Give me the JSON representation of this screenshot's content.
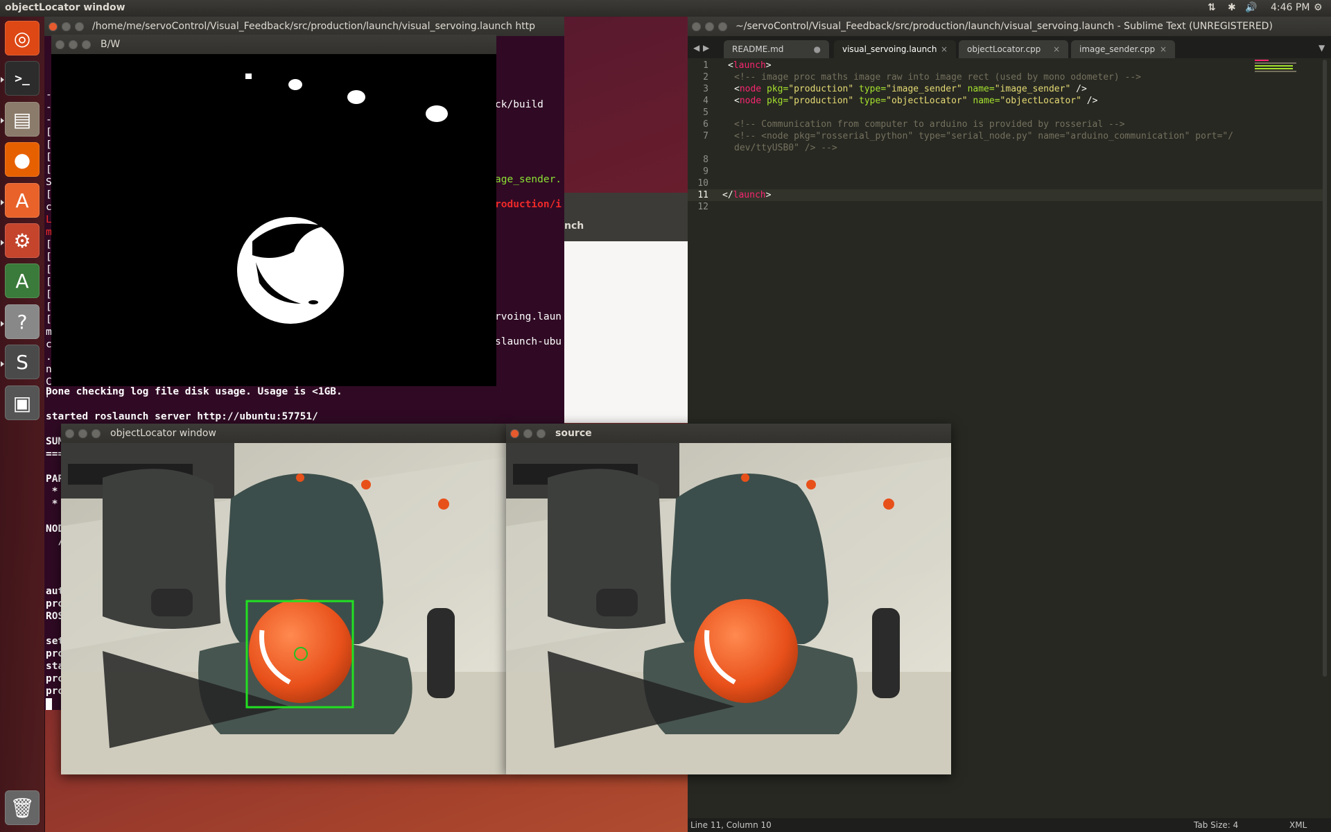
{
  "top_panel": {
    "title": "objectLocator window",
    "clock": "4:46 PM"
  },
  "launcher": {
    "items": [
      {
        "name": "ubuntu-dash-icon",
        "glyph": "◎",
        "color": "#dd4814"
      },
      {
        "name": "terminal-icon",
        "glyph": ">_",
        "color": "#2c2c2c"
      },
      {
        "name": "files-icon",
        "glyph": "▤",
        "color": "#8b7b6b"
      },
      {
        "name": "firefox-icon",
        "glyph": "●",
        "color": "#e66000"
      },
      {
        "name": "software-center-icon",
        "glyph": "A",
        "color": "#e8622a"
      },
      {
        "name": "system-settings-icon",
        "glyph": "⚙",
        "color": "#c4442c"
      },
      {
        "name": "update-manager-icon",
        "glyph": "A",
        "color": "#3a7a3a"
      },
      {
        "name": "help-icon",
        "glyph": "?",
        "color": "#888888"
      },
      {
        "name": "sublime-text-icon",
        "glyph": "S",
        "color": "#4a4a4a"
      },
      {
        "name": "save-icon",
        "glyph": "▣",
        "color": "#555555"
      },
      {
        "name": "trash-icon",
        "glyph": "🗑",
        "color": "#666666"
      }
    ]
  },
  "terminal": {
    "title": "/home/me/servoControl/Visual_Feedback/src/production/launch/visual_servoing.launch http",
    "right_fragments": [
      "ck/build",
      "age_sender.",
      "roduction/i",
      "rvoing.laun",
      "slaunch-ubu"
    ],
    "left_chars": [
      "-",
      "-",
      "-",
      "[",
      "[",
      "[",
      "[",
      "S",
      "[",
      "c",
      "L",
      "m",
      "[",
      "[",
      "[",
      "[",
      "[",
      "[",
      "[",
      "m",
      "c",
      ".",
      "n",
      "C",
      "P"
    ],
    "lines": [
      "Done checking log file disk usage. Usage is <1GB.",
      "",
      "started roslaunch server http://ubuntu:57751/",
      "",
      "SUM",
      "===",
      "",
      "PAR",
      " *",
      " *",
      "",
      "NOD",
      "  /",
      "",
      "",
      "",
      "aut",
      "pro",
      "ROS",
      "",
      "set",
      "pro",
      "sta",
      "pro",
      "pro"
    ],
    "partial_window_label": "nch"
  },
  "bw_window": {
    "title": "B/W"
  },
  "objectlocator_window": {
    "title": "objectLocator window"
  },
  "source_window": {
    "title": "source"
  },
  "sublime": {
    "title": "~/servoControl/Visual_Feedback/src/production/launch/visual_servoing.launch - Sublime Text (UNREGISTERED)",
    "tabs": [
      {
        "label": "README.md",
        "marker": "●",
        "active": false
      },
      {
        "label": "visual_servoing.launch",
        "marker": "×",
        "active": true
      },
      {
        "label": "objectLocator.cpp",
        "marker": "×",
        "active": false
      },
      {
        "label": "image_sender.cpp",
        "marker": "×",
        "active": false
      }
    ],
    "line_numbers": [
      "1",
      "2",
      "3",
      "4",
      "5",
      "6",
      "7",
      "",
      "8",
      "9",
      "10",
      "11",
      "12"
    ],
    "code": {
      "l1_open": "<",
      "l1_tag": "launch",
      "l1_close": ">",
      "l2": "<!-- image proc maths image raw into image rect (used by mono odometer) -->",
      "l3_a": "<",
      "l3_tag": "node",
      "l3_attr1": " pkg=",
      "l3_val1": "\"production\"",
      "l3_attr2": " type=",
      "l3_val2": "\"image_sender\"",
      "l3_attr3": " name=",
      "l3_val3": "\"image_sender\"",
      "l3_end": " />",
      "l4_a": "<",
      "l4_tag": "node",
      "l4_attr1": " pkg=",
      "l4_val1": "\"production\"",
      "l4_attr2": " type=",
      "l4_val2": "\"objectLocator\"",
      "l4_attr3": " name=",
      "l4_val3": "\"objectLocator\"",
      "l4_end": " />",
      "l6": "<!-- Communication from computer to arduino is provided by rosserial -->",
      "l7a": "<!-- <node pkg=\"rosserial_python\" type=\"serial_node.py\" name=\"arduino_communication\" port=\"/",
      "l7b": "dev/ttyUSB0\" /> -->",
      "l11_open": "</",
      "l11_tag": "launch",
      "l11_close": ">"
    },
    "status_left": "Line 11, Column 10",
    "status_tab": "Tab Size: 4",
    "status_syntax": "XML"
  }
}
